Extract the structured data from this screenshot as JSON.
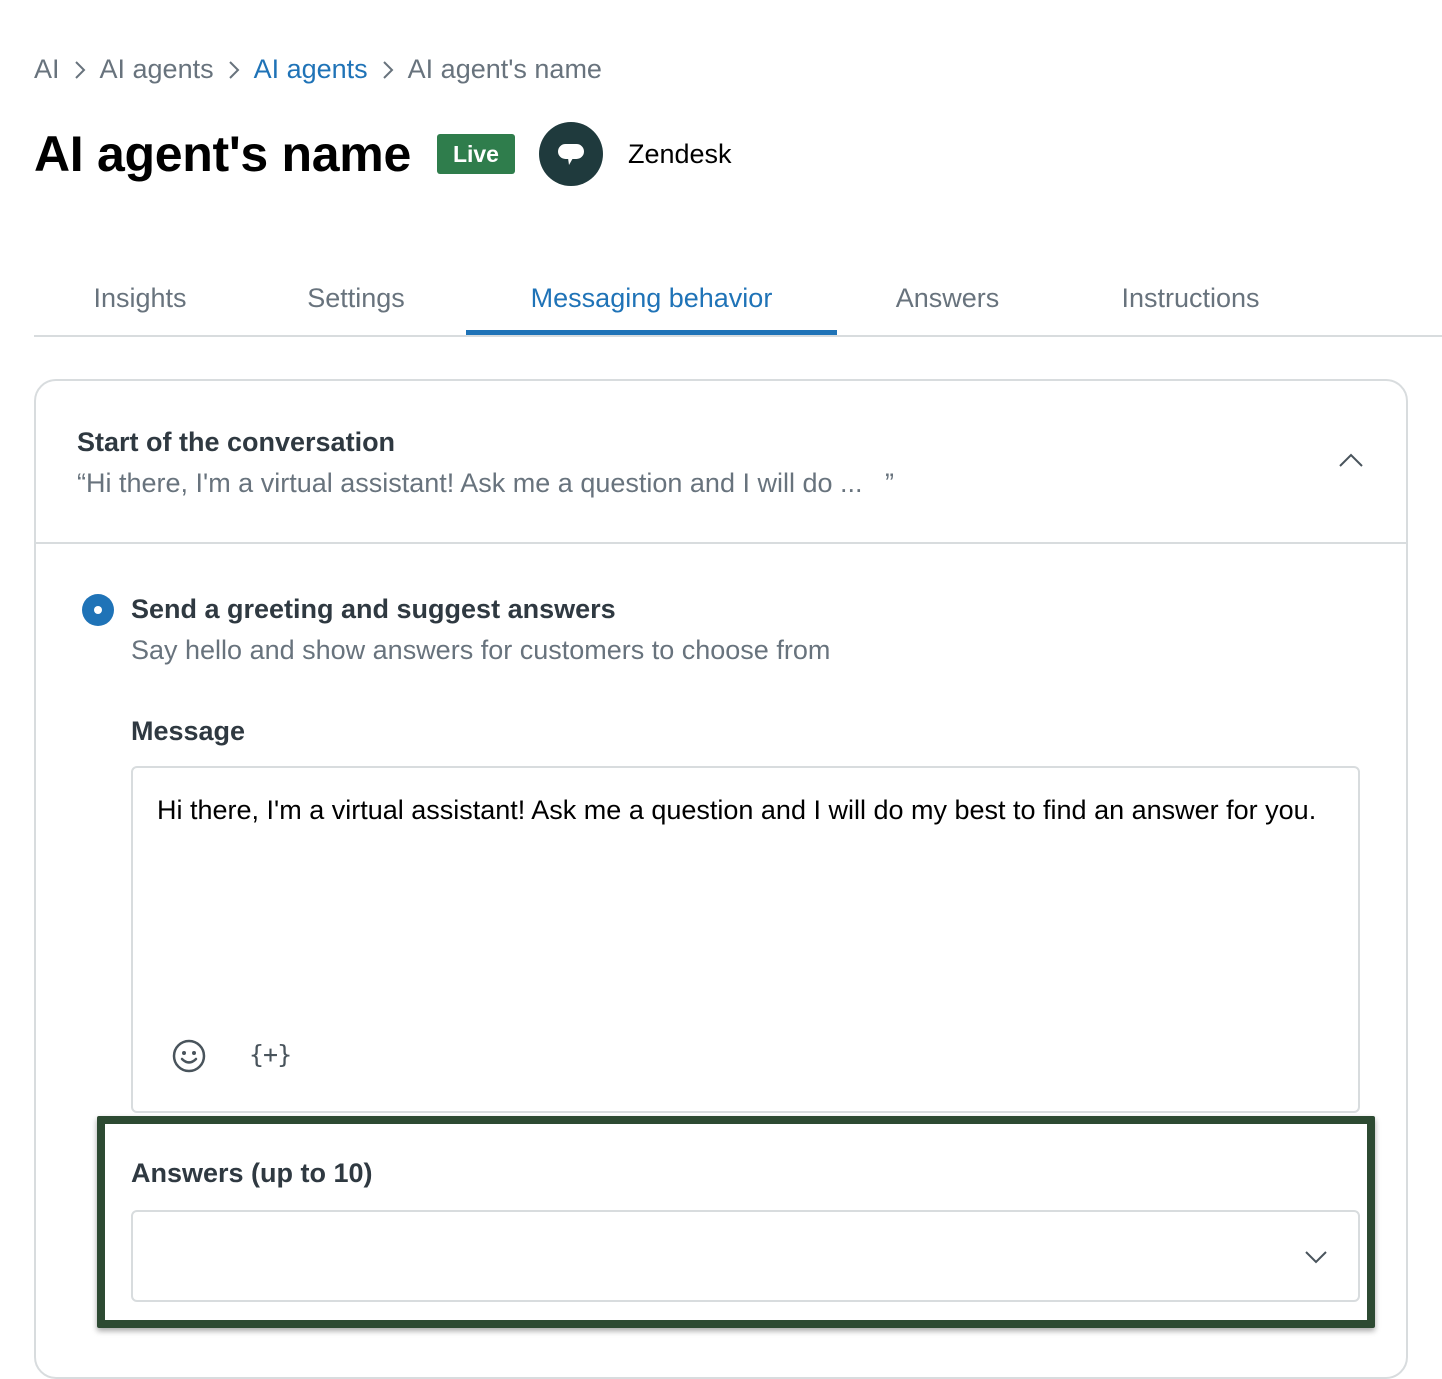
{
  "breadcrumb": {
    "items": [
      "AI",
      "AI agents",
      "AI agents",
      "AI agent's name"
    ]
  },
  "header": {
    "title": "AI agent's name",
    "status_badge": "Live",
    "channel_icon": "speech-bubble-icon",
    "channel_name": "Zendesk"
  },
  "tabs": [
    "Insights",
    "Settings",
    "Messaging behavior",
    "Answers",
    "Instructions"
  ],
  "active_tab": "Messaging behavior",
  "section": {
    "title": "Start of the conversation",
    "summary": "“Hi there, I'm a virtual assistant! Ask me a question and I will do ...   ”",
    "expanded": true
  },
  "option": {
    "selected": true,
    "title": "Send a greeting and suggest answers",
    "description": "Say hello and show answers for customers to choose from"
  },
  "message": {
    "label": "Message",
    "value": "Hi there, I'm a virtual assistant! Ask me a question and I will do my best to find an answer for you.",
    "toolbar": {
      "emoji_icon": "emoji-icon",
      "placeholder_label": "{+}"
    }
  },
  "answers": {
    "label": "Answers (up to 10)",
    "value": ""
  },
  "colors": {
    "accent": "#1f73b7",
    "live_badge": "#2f7d4c",
    "highlight": "#2d4a32",
    "avatar": "#1f3a3d"
  }
}
